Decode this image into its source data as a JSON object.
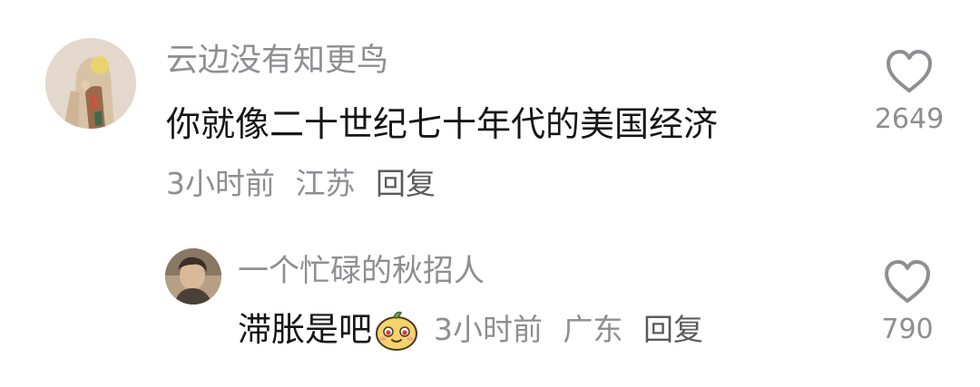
{
  "comment": {
    "username": "云边没有知更鸟",
    "text": "你就像二十世纪七十年代的美国经济",
    "time": "3小时前",
    "location": "江苏",
    "reply_label": "回复",
    "like_count": "2649",
    "like_icon": "heart-outline-icon"
  },
  "reply": {
    "username": "一个忙碌的秋招人",
    "text": "滞胀是吧",
    "emoji": "smug-face-emoji",
    "time": "3小时前",
    "location": "广东",
    "reply_label": "回复",
    "like_count": "790",
    "like_icon": "heart-outline-icon"
  },
  "colors": {
    "primary_text": "#161616",
    "secondary_text": "#8e8e93",
    "reply_link": "#5b5b5f",
    "heart_stroke": "#8e8e93"
  }
}
